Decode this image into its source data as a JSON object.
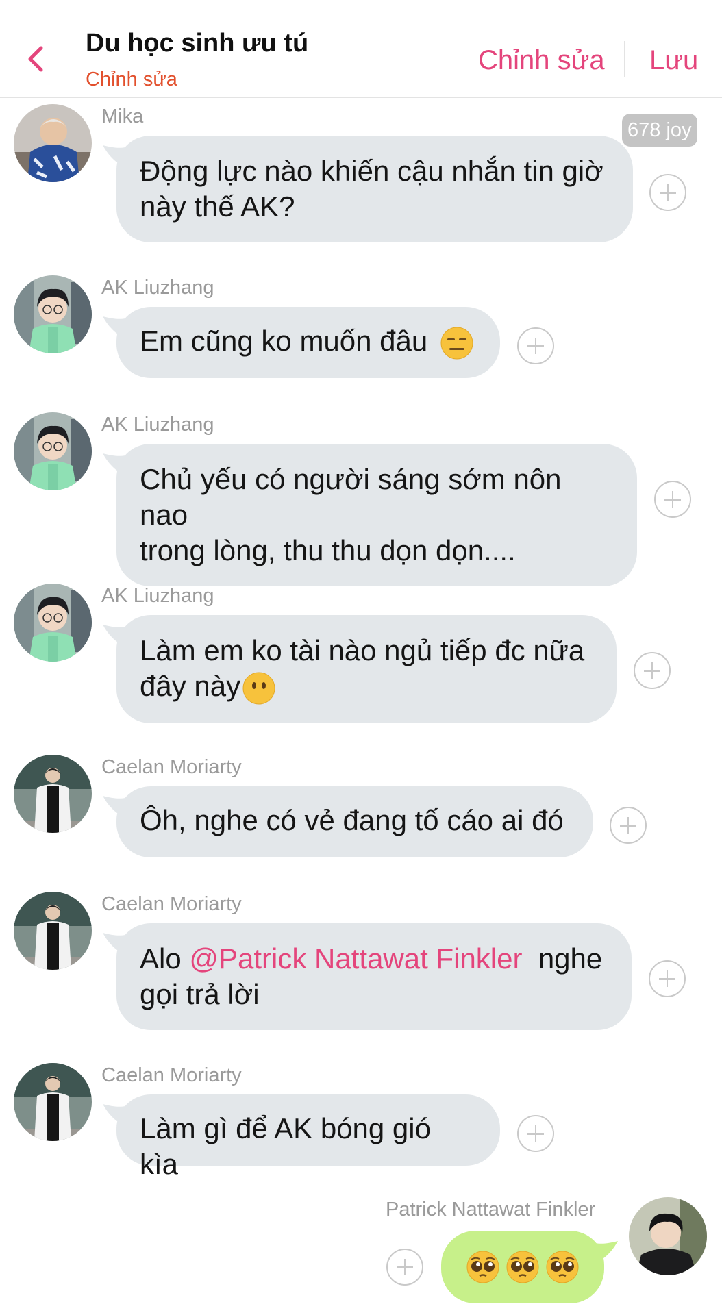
{
  "header": {
    "title": "Du học sinh ưu tú",
    "subtitle": "Chỉnh sửa",
    "edit_label": "Chỉnh sửa",
    "save_label": "Lưu",
    "accent": "#e4457c"
  },
  "joy_badge": "678 joy",
  "messages": [
    {
      "sender": "Mika",
      "line1": "Động lực nào khiến cậu nhắn tin giờ",
      "line2": "này thế AK?"
    },
    {
      "sender": "AK Liuzhang",
      "text": "Em cũng ko muốn đâu",
      "emoji": "expressionless-face-emoji"
    },
    {
      "sender": "AK Liuzhang",
      "line1": "Chủ yếu có người sáng sớm nôn nao",
      "line2": "trong lòng, thu thu dọn dọn...."
    },
    {
      "sender": "AK Liuzhang",
      "line1": "Làm em ko tài nào ngủ tiếp đc nữa",
      "line2": "đây này",
      "emoji": "face-without-mouth-emoji"
    },
    {
      "sender": "Caelan Moriarty",
      "text": "Ôh, nghe có vẻ đang tố cáo ai đó"
    },
    {
      "sender": "Caelan Moriarty",
      "pre": "Alo",
      "mention": "@Patrick Nattawat Finkler",
      "post": "nghe",
      "line2": "gọi trả lời"
    },
    {
      "sender": "Caelan Moriarty",
      "text": "Làm gì để AK bóng gió kìa"
    },
    {
      "sender": "Patrick Nattawat Finkler",
      "emoji": "pleading-face-emoji",
      "emoji_count": 3,
      "bubble_color": "#c7f08a"
    }
  ],
  "colors": {
    "bubble_incoming": "#e3e7ea",
    "bubble_outgoing": "#c7f08a",
    "name_gray": "#9a9a9a",
    "subtitle_orange": "#e2502d"
  }
}
